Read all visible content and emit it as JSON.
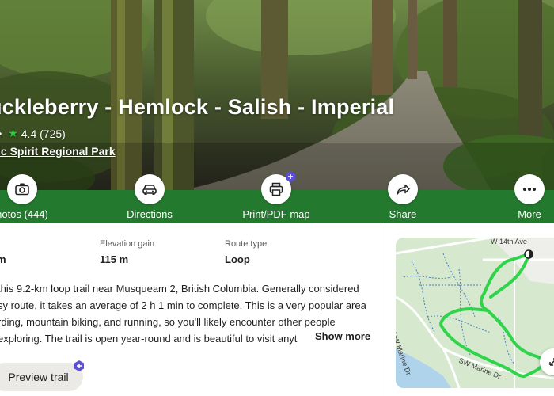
{
  "trail": {
    "title": "uckleberry - Hemlock - Salish - Imperial",
    "rating_prefix": "•",
    "rating": "4.4 (725)",
    "park": "ic Spirit Regional Park"
  },
  "actions": [
    {
      "label": "hotos (444)",
      "icon": "camera-icon"
    },
    {
      "label": "Directions",
      "icon": "car-icon"
    },
    {
      "label": "Print/PDF map",
      "icon": "printer-icon",
      "premium": true
    },
    {
      "label": "Share",
      "icon": "share-arrow-icon"
    },
    {
      "label": "More",
      "icon": "more-dots-icon"
    }
  ],
  "stats": {
    "length_value": "m",
    "elevation_label": "Elevation gain",
    "elevation_value": "115 m",
    "route_label": "Route type",
    "route_value": "Loop"
  },
  "description": {
    "line1": "this 9.2-km loop trail near Musqueam 2, British Columbia. Generally considered",
    "line2": "sy route, it takes an average of 2 h 1 min to complete. This is a very popular area",
    "line3": "rding, mountain biking, and running, so you'll likely encounter other people",
    "line4": "exploring. The trail is open year-round and is beautiful to visit anyt",
    "show_more": "Show more"
  },
  "preview_button": "Preview trail",
  "map": {
    "street_top": "W 14th Ave",
    "street_left": "NW Marine Dr",
    "street_bottom": "SW Marine Dr"
  },
  "colors": {
    "brand_green": "#237a2e",
    "trail_green": "#2fd44a",
    "premium_purple": "#5b4fd8"
  }
}
